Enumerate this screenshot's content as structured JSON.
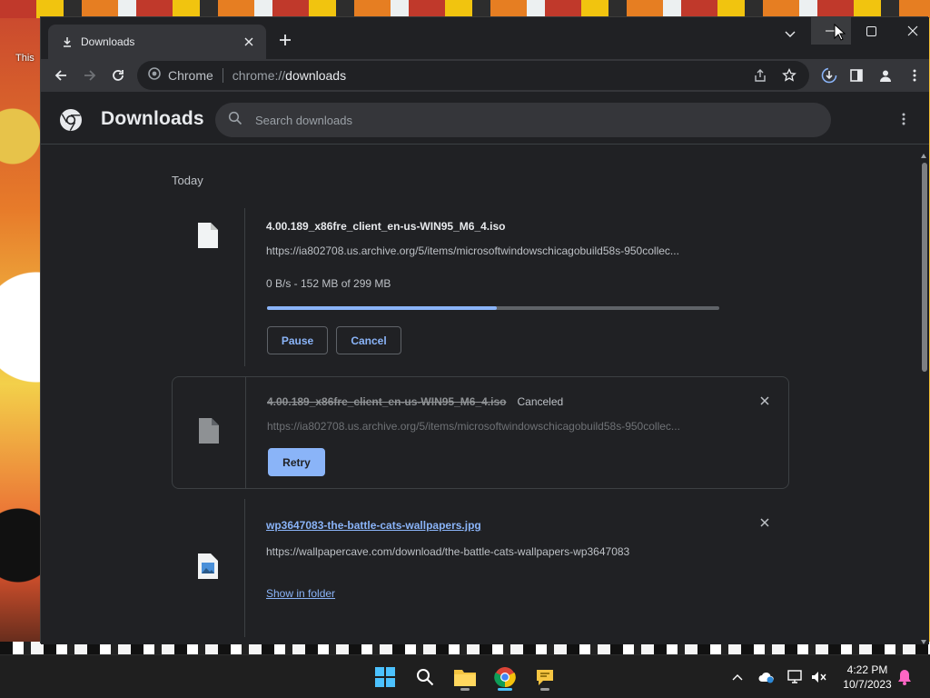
{
  "desktop": {
    "label": "This"
  },
  "browser": {
    "tab": {
      "title": "Downloads"
    },
    "omnibox": {
      "site": "Chrome",
      "url_scheme": "chrome://",
      "url_host": "downloads"
    }
  },
  "downloads_page": {
    "title": "Downloads",
    "search_placeholder": "Search downloads",
    "date_group": "Today",
    "items": [
      {
        "filename": "4.00.189_x86fre_client_en-us-WIN95_M6_4.iso",
        "url": "https://ia802708.us.archive.org/5/items/microsoftwindowschicagobuild58s-950collec...",
        "status": "0 B/s - 152 MB of 299 MB",
        "progress": 0.508,
        "pause_label": "Pause",
        "cancel_label": "Cancel"
      },
      {
        "filename": "4.00.189_x86fre_client_en-us-WIN95_M6_4.iso",
        "state": "Canceled",
        "url": "https://ia802708.us.archive.org/5/items/microsoftwindowschicagobuild58s-950collec...",
        "retry_label": "Retry"
      },
      {
        "filename": "wp3647083-the-battle-cats-wallpapers.jpg",
        "url": "https://wallpapercave.com/download/the-battle-cats-wallpapers-wp3647083",
        "show_folder_label": "Show in folder"
      }
    ]
  },
  "taskbar": {
    "time": "4:22 PM",
    "date": "10/7/2023",
    "apps": [
      "windows-start",
      "search",
      "file-explorer",
      "chrome",
      "feedback"
    ]
  },
  "colors": {
    "accent": "#8ab4f8",
    "page_bg": "#202124",
    "toolbar_bg": "#35363a"
  }
}
